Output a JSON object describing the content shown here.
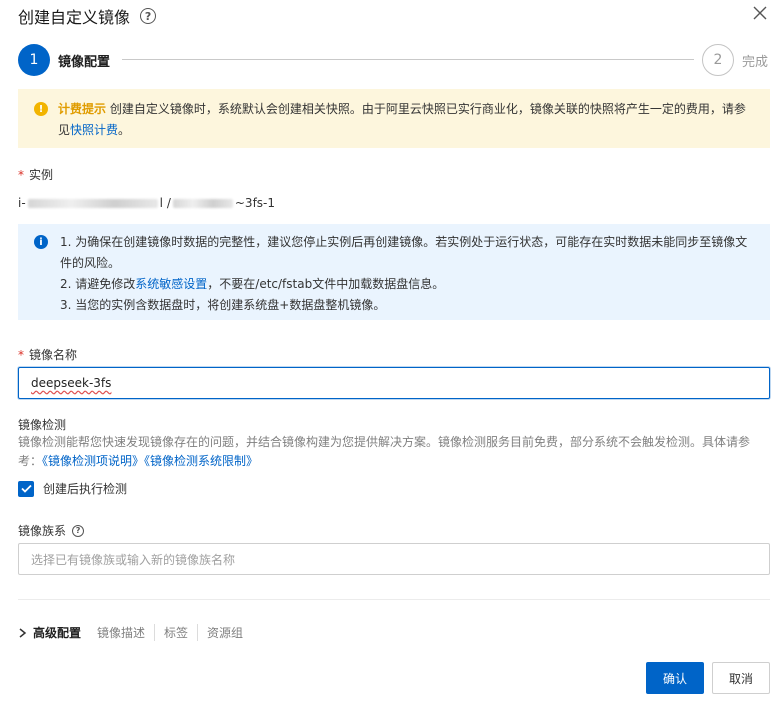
{
  "dialog": {
    "title": "创建自定义镜像",
    "help_icon": "question-circle-icon",
    "close_icon": "close-icon"
  },
  "steps": [
    {
      "number": "1",
      "label": "镜像配置",
      "state": "active"
    },
    {
      "number": "2",
      "label": "完成",
      "state": "pending"
    }
  ],
  "warning": {
    "icon": "warning-icon",
    "title": "计费提示",
    "text_before": " 创建自定义镜像时，系统默认会创建相关快照。由于阿里云快照已实行商业化，镜像关联的快照将产生一定的费用，请参见",
    "link": "快照计费",
    "text_after": "。"
  },
  "instance": {
    "required_mark": "*",
    "label": "实例",
    "value_prefix": "i-",
    "value_middle": "l / ",
    "value_suffix": "~3fs-1"
  },
  "info": {
    "icon": "info-icon",
    "line1": "1. 为确保在创建镜像时数据的完整性，建议您停止实例后再创建镜像。若实例处于运行状态，可能存在实时数据未能同步至镜像文件的风险。",
    "line2_before": "2. 请避免修改",
    "line2_link": "系统敏感设置",
    "line2_after": "，不要在/etc/fstab文件中加载数据盘信息。",
    "line3": "3. 当您的实例含数据盘时，将创建系统盘+数据盘整机镜像。"
  },
  "image_name": {
    "required_mark": "*",
    "label": "镜像名称",
    "value": "deepseek-3fs"
  },
  "image_check": {
    "label": "镜像检测",
    "description": "镜像检测能帮您快速发现镜像存在的问题，并结合镜像构建为您提供解决方案。镜像检测服务目前免费，部分系统不会触发检测。具体请参考：",
    "link1": "《镜像检测项说明》",
    "link2": "《镜像检测系统限制》",
    "checkbox_label": "创建后执行检测",
    "checkbox_checked": true
  },
  "image_family": {
    "label": "镜像族系",
    "placeholder": "选择已有镜像族或输入新的镜像族名称"
  },
  "advanced": {
    "title": "高级配置",
    "items": [
      "镜像描述",
      "标签",
      "资源组"
    ]
  },
  "footer": {
    "confirm": "确认",
    "cancel": "取消"
  },
  "colors": {
    "primary": "#0064c8",
    "warning_bg": "#fdf6dd",
    "warning_accent": "#e09c00",
    "info_bg": "#eaf4fe",
    "required": "#d93026"
  }
}
